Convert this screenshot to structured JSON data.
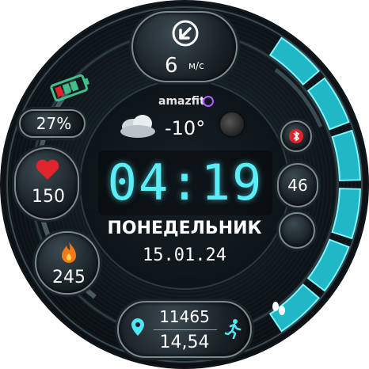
{
  "wind": {
    "value": "6",
    "unit": "м/с",
    "icon": "compass-arrow-icon"
  },
  "brand": {
    "logo_text": "amazfit"
  },
  "weather": {
    "temperature": "-10°",
    "icon": "cloud-icon",
    "moon_icon": "moon-phase-icon"
  },
  "battery": {
    "percent": "27%",
    "icon": "battery-icon"
  },
  "heart": {
    "value": "150",
    "icon": "heart-icon"
  },
  "calories": {
    "value": "245",
    "icon": "flame-icon"
  },
  "right_pods": {
    "value": "46",
    "top_icon": "bluetooth-off-icon"
  },
  "time": {
    "display": "04:19"
  },
  "date": {
    "weekday": "ПОНЕДЕЛЬНИК",
    "date": "15.01.24"
  },
  "steps": {
    "value": "11465",
    "distance": "14,54",
    "location_icon": "location-pin-icon",
    "run_icon": "running-icon"
  },
  "footsteps_icon": "footsteps-icon",
  "activity_scale": {
    "filled_segments": 6,
    "total_segments": 6
  },
  "colors": {
    "accent": "#4ee6f2",
    "heart": "#e0242b",
    "flame": "#f07a1a",
    "bluetooth_off": "#e0242b"
  }
}
